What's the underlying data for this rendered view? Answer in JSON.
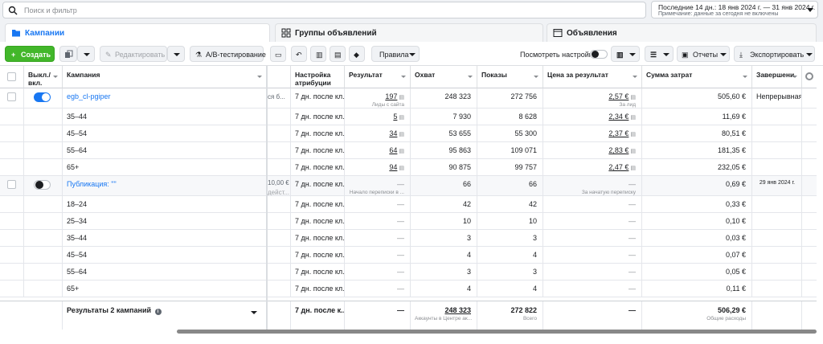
{
  "search": {
    "placeholder": "Поиск и фильтр"
  },
  "date_range": {
    "label": "Последние 14 дн.: 18 янв 2024 г. — 31 янв 2024 г.",
    "note": "Примечание: данные за сегодня не включены"
  },
  "tabs": [
    {
      "label": "Кампании"
    },
    {
      "label": "Группы объявлений"
    },
    {
      "label": "Объявления"
    }
  ],
  "toolbar": {
    "create": "Создать",
    "edit": "Редактировать",
    "ab_test": "A/B-тестирование",
    "rules": "Правила",
    "view_settings": "Посмотреть настройки",
    "reports": "Отчеты",
    "export": "Экспортировать"
  },
  "columns": {
    "toggle": "Выкл./вкл.",
    "campaign": "Кампания",
    "attribution": "Настройка атрибуции",
    "result": "Результат",
    "reach": "Охват",
    "impressions": "Показы",
    "cost_per_result": "Цена за результат",
    "amount_spent": "Сумма затрат",
    "ends": "Завершени"
  },
  "ghost_text": {
    "row1": "ся б...",
    "row6_budget": "10,00 €",
    "row6_status": "дейст..."
  },
  "rows": [
    {
      "name": "egb_cl-pgiper",
      "attribution": "7 дн. после кл...",
      "result": "197",
      "result_sub": "Лиды с сайта",
      "reach": "248 323",
      "impressions": "272 756",
      "cpr": "2,57 €",
      "cpr_sub": "За лид",
      "spent": "505,60 €",
      "ends": "Непрерывная"
    },
    {
      "name": "35–44",
      "attribution": "7 дн. после кл...",
      "result": "5",
      "reach": "7 930",
      "impressions": "8 628",
      "cpr": "2,34 €",
      "spent": "11,69 €"
    },
    {
      "name": "45–54",
      "attribution": "7 дн. после кл...",
      "result": "34",
      "reach": "53 655",
      "impressions": "55 300",
      "cpr": "2,37 €",
      "spent": "80,51 €"
    },
    {
      "name": "55–64",
      "attribution": "7 дн. после кл...",
      "result": "64",
      "reach": "95 863",
      "impressions": "109 071",
      "cpr": "2,83 €",
      "spent": "181,35 €"
    },
    {
      "name": "65+",
      "attribution": "7 дн. после кл...",
      "result": "94",
      "reach": "90 875",
      "impressions": "99 757",
      "cpr": "2,47 €",
      "spent": "232,05 €"
    },
    {
      "name": "Публикация: \"\"",
      "attribution": "7 дн. после кл...",
      "result": "—",
      "result_sub": "Начало переписки в ...",
      "reach": "66",
      "impressions": "66",
      "cpr": "—",
      "cpr_sub": "За начатую переписку",
      "spent": "0,69 €",
      "ends": "29 янв 2024 г."
    },
    {
      "name": "18–24",
      "attribution": "7 дн. после кл...",
      "result": "—",
      "reach": "42",
      "impressions": "42",
      "cpr": "—",
      "spent": "0,33 €"
    },
    {
      "name": "25–34",
      "attribution": "7 дн. после кл...",
      "result": "—",
      "reach": "10",
      "impressions": "10",
      "cpr": "—",
      "spent": "0,10 €"
    },
    {
      "name": "35–44",
      "attribution": "7 дн. после кл...",
      "result": "—",
      "reach": "3",
      "impressions": "3",
      "cpr": "—",
      "spent": "0,03 €"
    },
    {
      "name": "45–54",
      "attribution": "7 дн. после кл...",
      "result": "—",
      "reach": "4",
      "impressions": "4",
      "cpr": "—",
      "spent": "0,07 €"
    },
    {
      "name": "55–64",
      "attribution": "7 дн. после кл...",
      "result": "—",
      "reach": "3",
      "impressions": "3",
      "cpr": "—",
      "spent": "0,05 €"
    },
    {
      "name": "65+",
      "attribution": "7 дн. после кл...",
      "result": "—",
      "reach": "4",
      "impressions": "4",
      "cpr": "—",
      "spent": "0,11 €"
    }
  ],
  "totals": {
    "label": "Результаты 2 кампаний",
    "attribution": "7 дн. после к...",
    "result": "—",
    "reach": "248 323",
    "reach_sub": "Аккаунты в Центре ак...",
    "impressions": "272 822",
    "impressions_sub": "Всего",
    "cpr": "—",
    "spent": "506,29 €",
    "spent_sub": "Общие расходы"
  }
}
